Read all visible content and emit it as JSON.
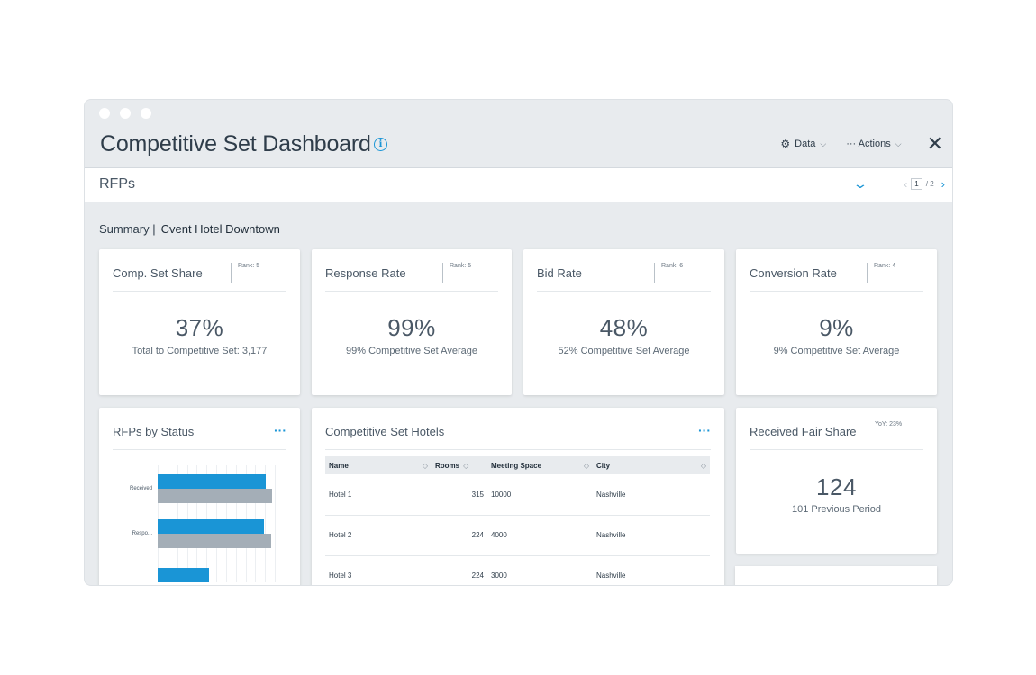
{
  "window": {
    "title": "Competitive Set Dashboard",
    "info_icon": "info-icon",
    "data_menu": "Data",
    "actions_menu": "··· Actions",
    "close_icon": "close-icon"
  },
  "rfps_bar": {
    "label": "RFPs",
    "pager_current": "1",
    "pager_total": "/ 2"
  },
  "summary": {
    "label": "Summary |",
    "hotel": "Cvent Hotel Downtown"
  },
  "metrics": [
    {
      "title": "Comp. Set Share",
      "rank": "Rank: 5",
      "value": "37%",
      "subtitle": "Total to Competitive Set: 3,177"
    },
    {
      "title": "Response Rate",
      "rank": "Rank: 5",
      "value": "99%",
      "subtitle": "99% Competitive Set Average"
    },
    {
      "title": "Bid Rate",
      "rank": "Rank: 6",
      "value": "48%",
      "subtitle": "52% Competitive Set Average"
    },
    {
      "title": "Conversion Rate",
      "rank": "Rank: 4",
      "value": "9%",
      "subtitle": "9% Competitive Set Average"
    }
  ],
  "rfps_by_status": {
    "title": "RFPs by Status",
    "more": "···",
    "categories": [
      "Received",
      "Respo..."
    ]
  },
  "chart_data": {
    "type": "bar",
    "orientation": "horizontal",
    "categories": [
      "Received",
      "Respo...",
      ""
    ],
    "series": [
      {
        "values": [
          92,
          91,
          44
        ],
        "color": "#1a95d6"
      },
      {
        "values": [
          98,
          97,
          null
        ],
        "color": "#a4aeb7"
      }
    ],
    "grid": true
  },
  "competitive_set_hotels": {
    "title": "Competitive Set Hotels",
    "more": "···",
    "columns": [
      "Name",
      "Rooms",
      "Meeting Space",
      "City"
    ],
    "rows": [
      [
        "Hotel 1",
        "315",
        "10000",
        "Nashville"
      ],
      [
        "Hotel 2",
        "224",
        "4000",
        "Nashville"
      ],
      [
        "Hotel 3",
        "224",
        "3000",
        "Nashville"
      ]
    ]
  },
  "received_fair_share": {
    "title": "Received Fair Share",
    "yoy": "YoY: 23%",
    "value": "124",
    "subtitle": "101 Previous Period"
  }
}
